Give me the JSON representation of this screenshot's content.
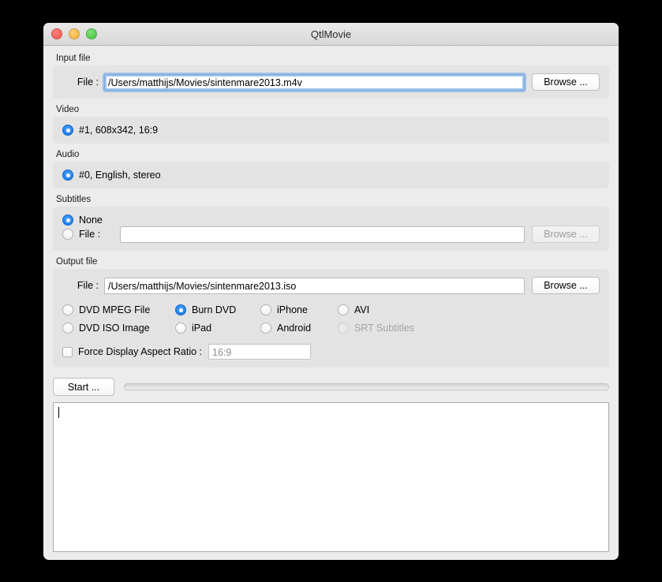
{
  "window": {
    "title": "QtlMovie",
    "controls": {
      "close": "close-button",
      "minimize": "minimize-button",
      "zoom": "zoom-button"
    }
  },
  "input_file": {
    "group_title": "Input file",
    "file_label": "File :",
    "file_value": "/Users/matthijs/Movies/sintenmare2013.m4v",
    "browse_label": "Browse ..."
  },
  "video": {
    "group_title": "Video",
    "options": [
      {
        "label": "#1, 608x342, 16:9",
        "selected": true
      }
    ]
  },
  "audio": {
    "group_title": "Audio",
    "options": [
      {
        "label": "#0, English, stereo",
        "selected": true
      }
    ]
  },
  "subtitles": {
    "group_title": "Subtitles",
    "none_label": "None",
    "file_label": "File :",
    "file_value": "",
    "file_placeholder": "",
    "browse_label": "Browse ..."
  },
  "output_file": {
    "group_title": "Output file",
    "file_label": "File :",
    "file_value": "/Users/matthijs/Movies/sintenmare2013.iso",
    "browse_label": "Browse ...",
    "formats": [
      {
        "label": "DVD MPEG File",
        "selected": false,
        "disabled": false
      },
      {
        "label": "Burn DVD",
        "selected": true,
        "disabled": false
      },
      {
        "label": "iPhone",
        "selected": false,
        "disabled": false
      },
      {
        "label": "AVI",
        "selected": false,
        "disabled": false
      },
      {
        "label": "DVD ISO Image",
        "selected": false,
        "disabled": false
      },
      {
        "label": "iPad",
        "selected": false,
        "disabled": false
      },
      {
        "label": "Android",
        "selected": false,
        "disabled": false
      },
      {
        "label": "SRT Subtitles",
        "selected": false,
        "disabled": true
      }
    ],
    "force_dar_label": "Force Display Aspect Ratio :",
    "force_dar_checked": false,
    "dar_value": "16:9"
  },
  "actions": {
    "start_label": "Start ...",
    "progress_percent": 0
  },
  "log": {
    "text": ""
  },
  "colors": {
    "accent": "#1478e8",
    "window_bg": "#ececec",
    "group_bg": "#e3e3e3",
    "focus_ring": "#9fc3ee"
  }
}
